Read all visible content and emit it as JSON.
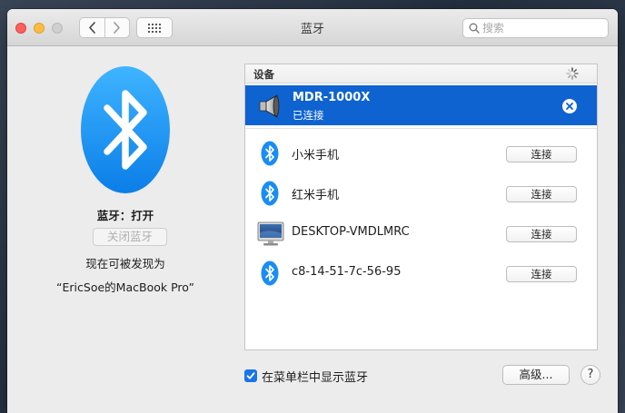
{
  "window": {
    "title": "蓝牙"
  },
  "search": {
    "placeholder": "搜索"
  },
  "left": {
    "state_label": "蓝牙：打开",
    "toggle_label": "关闭蓝牙",
    "discoverable_line": "现在可被发现为",
    "device_name_line": "“EricSoe的MacBook Pro”"
  },
  "devices": {
    "header": "设备",
    "connected": {
      "name": "MDR-1000X",
      "status": "已连接",
      "icon": "speaker-icon"
    },
    "list": [
      {
        "name": "小米手机",
        "button": "连接",
        "icon": "bluetooth-icon"
      },
      {
        "name": "红米手机",
        "button": "连接",
        "icon": "bluetooth-icon"
      },
      {
        "name": "DESKTOP-VMDLMRC",
        "button": "连接",
        "icon": "monitor-icon"
      },
      {
        "name": "c8-14-51-7c-56-95",
        "button": "连接",
        "icon": "bluetooth-icon"
      }
    ]
  },
  "footer": {
    "show_in_menubar": "在菜单栏中显示蓝牙",
    "show_in_menubar_checked": true,
    "advanced": "高级...",
    "help": "?"
  },
  "colors": {
    "selection": "#0e63d0",
    "bluetooth_blue": "#1a8cf5",
    "checkbox": "#1a74e8"
  }
}
